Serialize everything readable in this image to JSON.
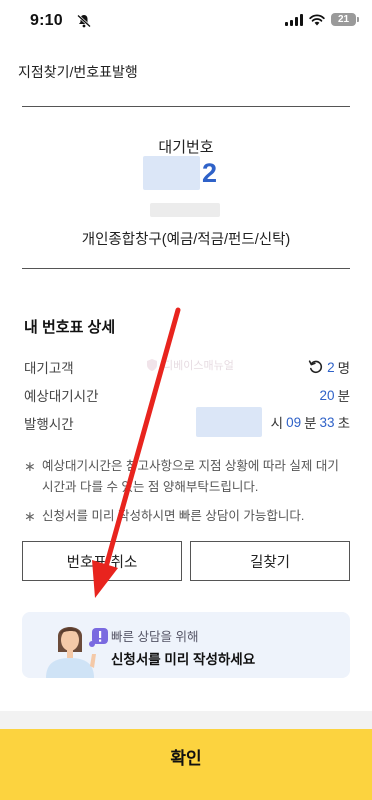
{
  "status_bar": {
    "time": "9:10",
    "battery": "21"
  },
  "breadcrumb": "지점찾기/번호표발행",
  "ticket": {
    "label": "대기번호",
    "number": "2",
    "counter": "개인종합창구(예금/적금/펀드/신탁)"
  },
  "details": {
    "title": "내 번호표 상세",
    "waiting_customers": {
      "label": "대기고객",
      "value": "2",
      "unit": "명"
    },
    "estimated_wait": {
      "label": "예상대기시간",
      "value": "20",
      "unit": "분"
    },
    "issued_time": {
      "label": "발행시간",
      "hour_unit": "시",
      "minute": "09",
      "minute_unit": "분",
      "second": "33",
      "second_unit": "초"
    }
  },
  "watermark": "디베이스매뉴얼",
  "notes": [
    "예상대기시간은 참고사항으로 지점 상황에 따라 실제 대기시간과 다를 수 있는 점 양해부탁드립니다.",
    "신청서를 미리 작성하시면 빠른 상담이 가능합니다."
  ],
  "buttons": {
    "cancel": "번호표 취소",
    "directions": "길찾기"
  },
  "banner": {
    "subtitle": "빠른 상담을 위해",
    "title": "신청서를 미리 작성하세요"
  },
  "confirm": "확인",
  "colors": {
    "accent_blue": "#2f62c8",
    "confirm_yellow": "#fcd33f",
    "arrow_red": "#e8241e"
  }
}
